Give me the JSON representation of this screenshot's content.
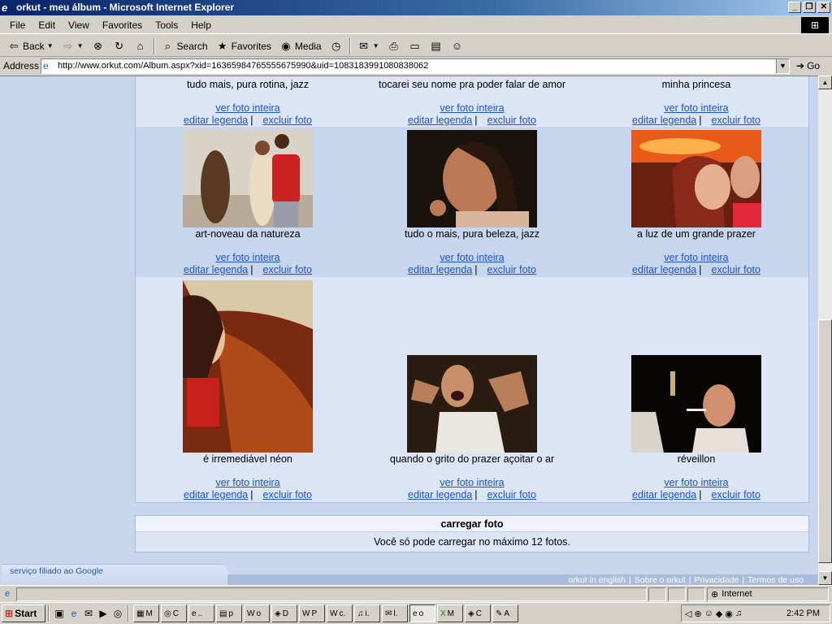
{
  "window": {
    "title": "orkut - meu álbum - Microsoft Internet Explorer"
  },
  "menu": [
    "File",
    "Edit",
    "View",
    "Favorites",
    "Tools",
    "Help"
  ],
  "toolbar": {
    "back": "Back",
    "search": "Search",
    "favorites": "Favorites",
    "media": "Media"
  },
  "address": {
    "label": "Address",
    "url": "http://www.orkut.com/Album.aspx?xid=16365984765555675990&uid=1083183991080838062",
    "go": "Go"
  },
  "album": {
    "link_view": "ver foto inteira",
    "link_edit": "editar legenda",
    "link_delete": "excluir foto",
    "row0_captions": [
      "tudo mais, pura rotina, jazz",
      "tocarei seu nome pra poder falar de amor",
      "minha princesa"
    ],
    "row1": [
      {
        "caption": "art-noveau da natureza"
      },
      {
        "caption": "tudo o mais, pura beleza, jazz"
      },
      {
        "caption": "a luz de um grande prazer"
      }
    ],
    "row2": [
      {
        "caption": "é irremediável néon"
      },
      {
        "caption": "quando o grito do prazer açoitar o ar"
      },
      {
        "caption": "réveillon"
      }
    ]
  },
  "upload": {
    "title": "carregar foto",
    "message": "Você só pode carregar no máximo 12 fotos."
  },
  "footer": {
    "google": "serviço filiado ao Google",
    "links": [
      "orkut in english",
      "Sobre o orkut",
      "Privacidade",
      "Termos de uso"
    ]
  },
  "status": {
    "zone": "Internet"
  },
  "taskbar": {
    "start": "Start",
    "tasks": [
      "M",
      "C",
      "..",
      "p",
      "o",
      "D",
      "P",
      "c.",
      "i.",
      "l.",
      "o",
      "M",
      "C",
      "A"
    ],
    "clock": "2:42 PM"
  }
}
